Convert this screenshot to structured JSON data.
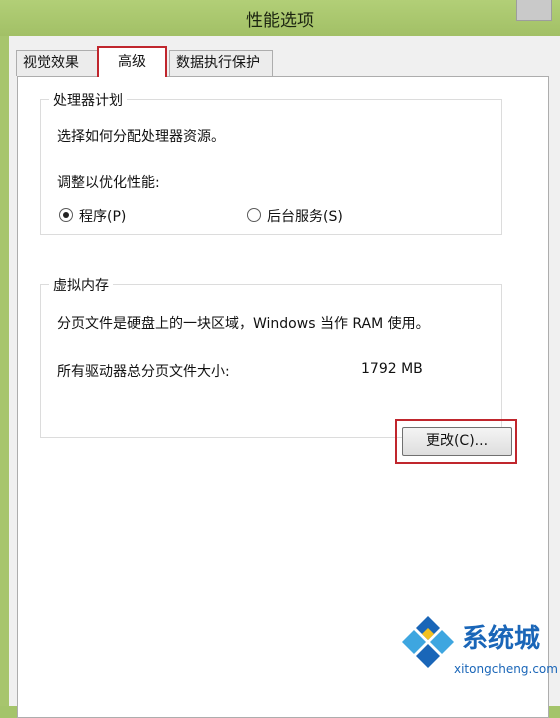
{
  "window": {
    "title": "性能选项"
  },
  "tabs": [
    {
      "label": "视觉效果",
      "active": false
    },
    {
      "label": "高级",
      "active": true
    },
    {
      "label": "数据执行保护",
      "active": false
    }
  ],
  "processor": {
    "title": "处理器计划",
    "description": "选择如何分配处理器资源。",
    "optimize_label": "调整以优化性能:",
    "options": [
      {
        "label": "程序(P)",
        "checked": true
      },
      {
        "label": "后台服务(S)",
        "checked": false
      }
    ]
  },
  "virtual_memory": {
    "title": "虚拟内存",
    "description": "分页文件是硬盘上的一块区域，Windows 当作 RAM 使用。",
    "total_label": "所有驱动器总分页文件大小:",
    "total_value": "1792 MB",
    "change_button": "更改(C)..."
  },
  "watermark": {
    "name": "系统城",
    "url": "xitongcheng.com"
  },
  "colors": {
    "highlight": "#c0262d",
    "accent": "#a7c56d",
    "logo": "#1a66b8"
  }
}
